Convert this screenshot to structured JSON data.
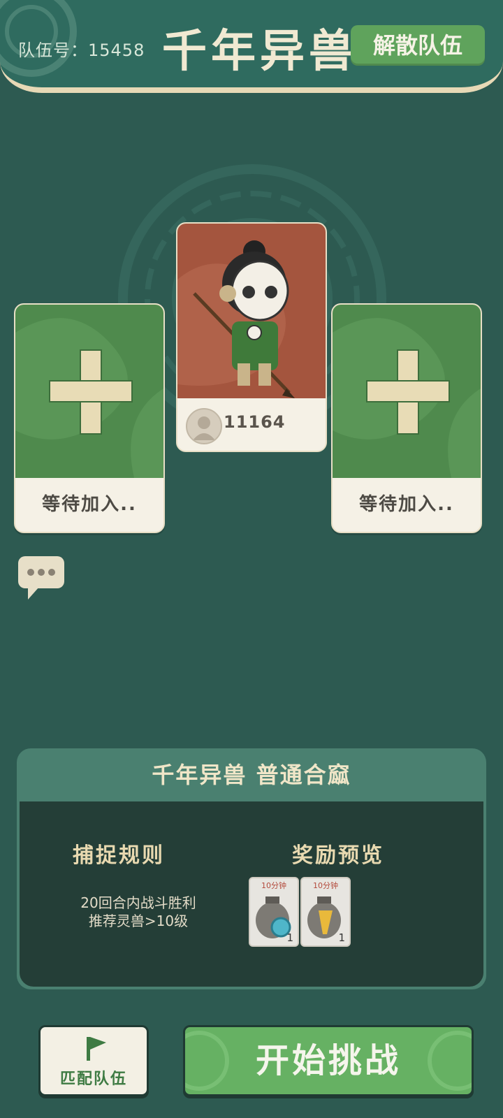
{
  "header": {
    "team_number": "队伍号：15458",
    "title": "千年异兽",
    "disband_label": "解散队伍"
  },
  "slots": {
    "left_label": "等待加入..",
    "right_label": "等待加入.."
  },
  "player": {
    "id": "11164"
  },
  "info": {
    "title": "千年异兽  普通合窳",
    "rule_heading": "捕捉规则",
    "reward_heading": "奖励预览",
    "rules": [
      "20回合内战斗胜利",
      "推荐灵兽>10级"
    ],
    "rewards": [
      {
        "time": "10分钟",
        "qty": "1",
        "icon": "blue-item-bag-icon"
      },
      {
        "time": "10分钟",
        "qty": "1",
        "icon": "gold-item-bag-icon"
      }
    ]
  },
  "buttons": {
    "match_label": "匹配队伍",
    "challenge_label": "开始挑战"
  },
  "colors": {
    "background": "#2d5a51",
    "header": "#2f6b5f",
    "accent_green": "#66b163",
    "card_green": "#4f8a4d",
    "card_red": "#a4553e",
    "cream": "#f5f1e6"
  }
}
